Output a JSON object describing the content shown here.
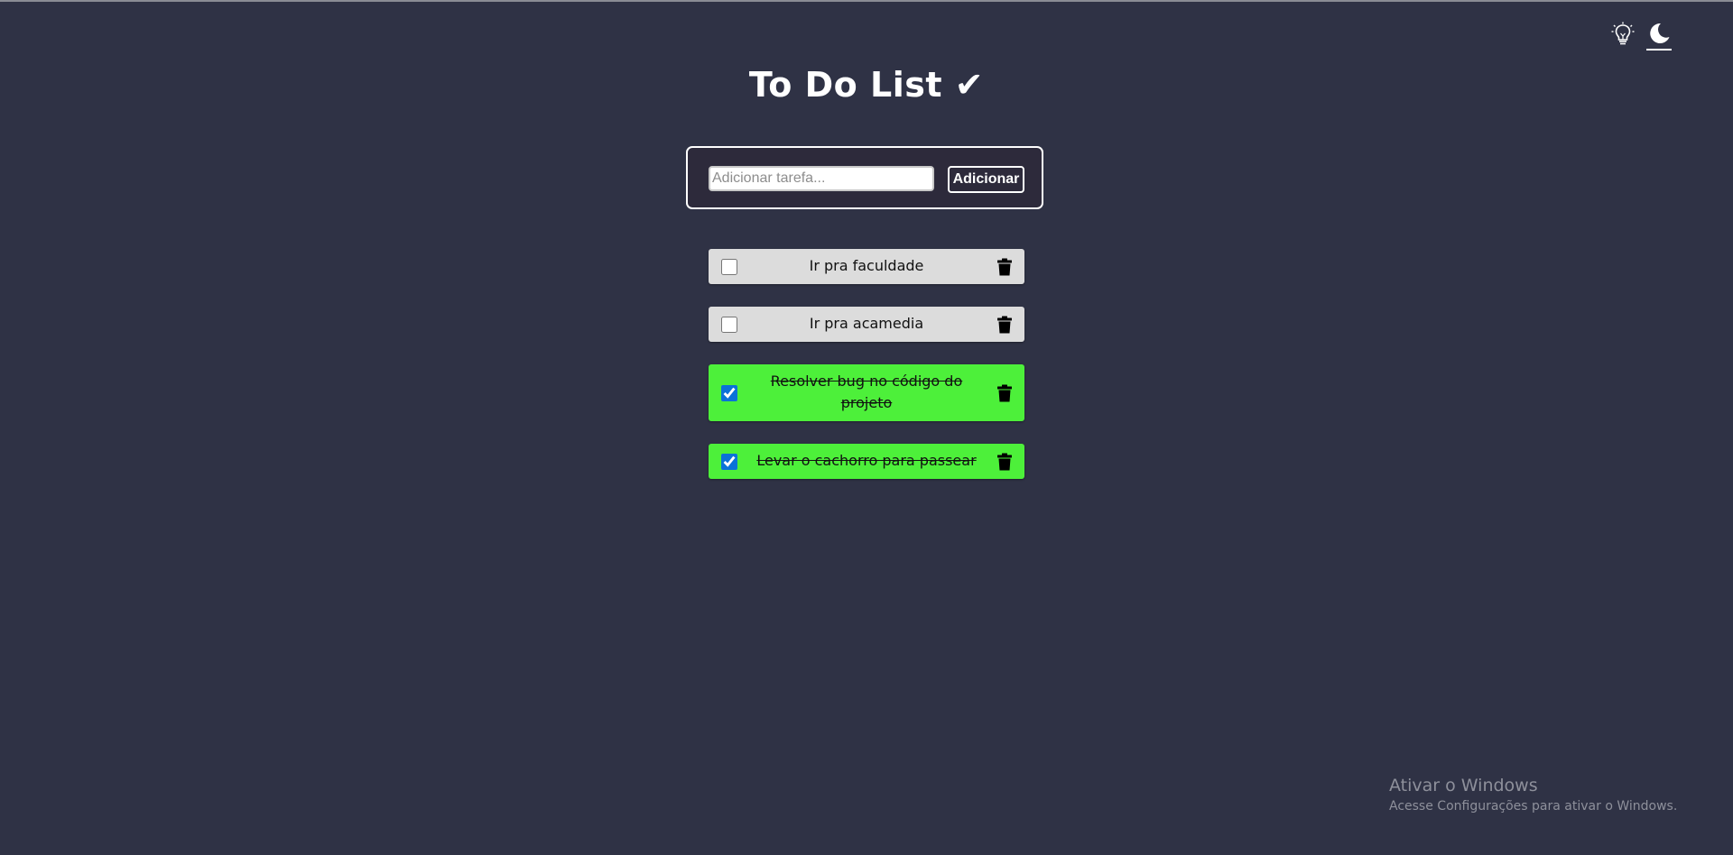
{
  "theme_switch": {
    "light_icon": "lightbulb-icon",
    "dark_icon": "moon-icon",
    "active": "dark"
  },
  "header": {
    "title": "To Do List ✔"
  },
  "add_form": {
    "placeholder": "Adicionar tarefa...",
    "value": "",
    "button_label": "Adicionar"
  },
  "tasks": [
    {
      "text": "Ir pra faculdade",
      "done": false
    },
    {
      "text": "Ir pra acamedia",
      "done": false
    },
    {
      "text": "Resolver bug no código do projeto",
      "done": true
    },
    {
      "text": "Levar o cachorro para passear",
      "done": true
    }
  ],
  "colors": {
    "background": "#2f3245",
    "task_pending": "#dcdcdc",
    "task_done": "#4df03a"
  },
  "watermark": {
    "title": "Ativar o Windows",
    "subtitle": "Acesse Configurações para ativar o Windows."
  }
}
